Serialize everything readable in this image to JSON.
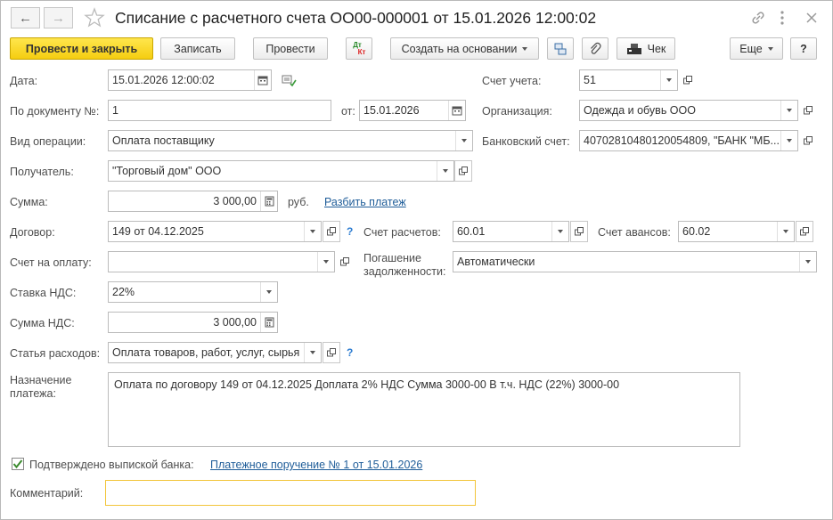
{
  "window": {
    "title": "Списание с расчетного счета ОО00-000001 от 15.01.2026 12:00:02"
  },
  "toolbar": {
    "post_close": "Провести и закрыть",
    "save": "Записать",
    "post": "Провести",
    "dt_label": "Дт",
    "kt_label": "Кт",
    "create_based": "Создать на основании",
    "check": "Чек",
    "more": "Еще",
    "help": "?"
  },
  "form": {
    "date_label": "Дата:",
    "date_value": "15.01.2026 12:00:02",
    "account_label": "Счет учета:",
    "account_value": "51",
    "doc_no_label": "По документу №:",
    "doc_no_value": "1",
    "from_label": "от:",
    "from_value": "15.01.2026",
    "org_label": "Организация:",
    "org_value": "Одежда и обувь ООО",
    "op_type_label": "Вид операции:",
    "op_type_value": "Оплата поставщику",
    "bank_acc_label": "Банковский счет:",
    "bank_acc_value": "40702810480120054809, \"БАНК \"МБ...",
    "recipient_label": "Получатель:",
    "recipient_value": "\"Торговый дом\" ООО",
    "sum_label": "Сумма:",
    "sum_value": "3 000,00",
    "currency": "руб.",
    "split_link": "Разбить платеж",
    "contract_label": "Договор:",
    "contract_value": "149 от 04.12.2025",
    "settle_acc_label": "Счет расчетов:",
    "settle_acc_value": "60.01",
    "advance_acc_label": "Счет авансов:",
    "advance_acc_value": "60.02",
    "invoice_label": "Счет на оплату:",
    "invoice_value": "",
    "repay_label_1": "Погашение",
    "repay_label_2": "задолженности:",
    "repay_value": "Автоматически",
    "vat_rate_label": "Ставка НДС:",
    "vat_rate_value": "22%",
    "vat_sum_label": "Сумма НДС:",
    "vat_sum_value": "3 000,00",
    "expense_label": "Статья расходов:",
    "expense_value": "Оплата товаров, работ, услуг, сырья",
    "purpose_label_1": "Назначение",
    "purpose_label_2": "платежа:",
    "purpose_value": "Оплата по договору 149 от 04.12.2025 Доплата 2% НДС  Сумма 3000-00 В т.ч. НДС  (22%) 3000-00",
    "confirmed_label": "Подтверждено выпиской банка:",
    "payment_order_link": "Платежное поручение № 1 от 15.01.2026",
    "comment_label": "Комментарий:",
    "comment_value": "",
    "help_q": "?"
  }
}
